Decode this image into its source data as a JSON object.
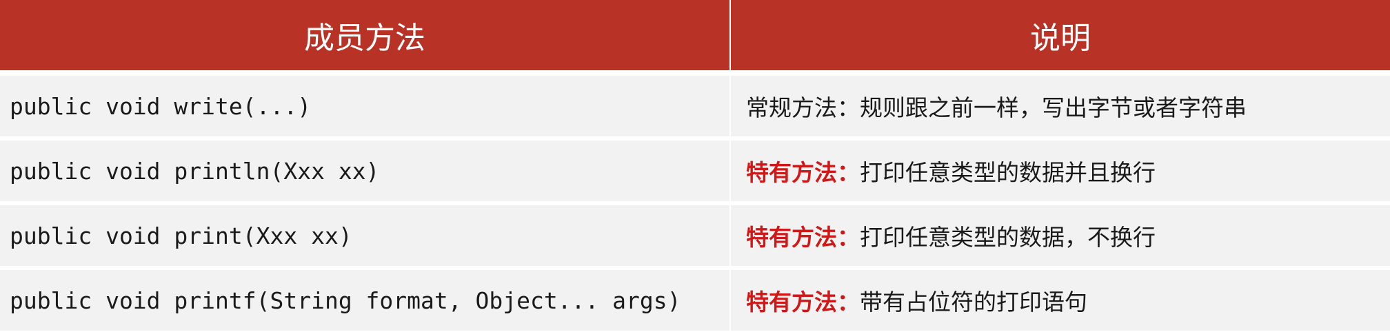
{
  "table": {
    "headers": [
      "成员方法",
      "说明"
    ],
    "rows": [
      {
        "method": "public void write(...)",
        "desc_prefix": "常规方法：",
        "desc_text": "规则跟之前一样，写出字节或者字符串"
      },
      {
        "method": "public void println(Xxx xx)",
        "desc_prefix": "特有方法：",
        "desc_text": "打印任意类型的数据并且换行"
      },
      {
        "method": "public void print(Xxx xx)",
        "desc_prefix": "特有方法：",
        "desc_text": "打印任意类型的数据，不换行"
      },
      {
        "method": "public void printf(String format, Object... args)",
        "desc_prefix": "特有方法：",
        "desc_text": "带有占位符的打印语句"
      }
    ]
  },
  "colors": {
    "header_bg": "#b83225",
    "header_text": "#ffffff",
    "row_bg": "#f2f2f2",
    "highlight": "#d01818"
  }
}
